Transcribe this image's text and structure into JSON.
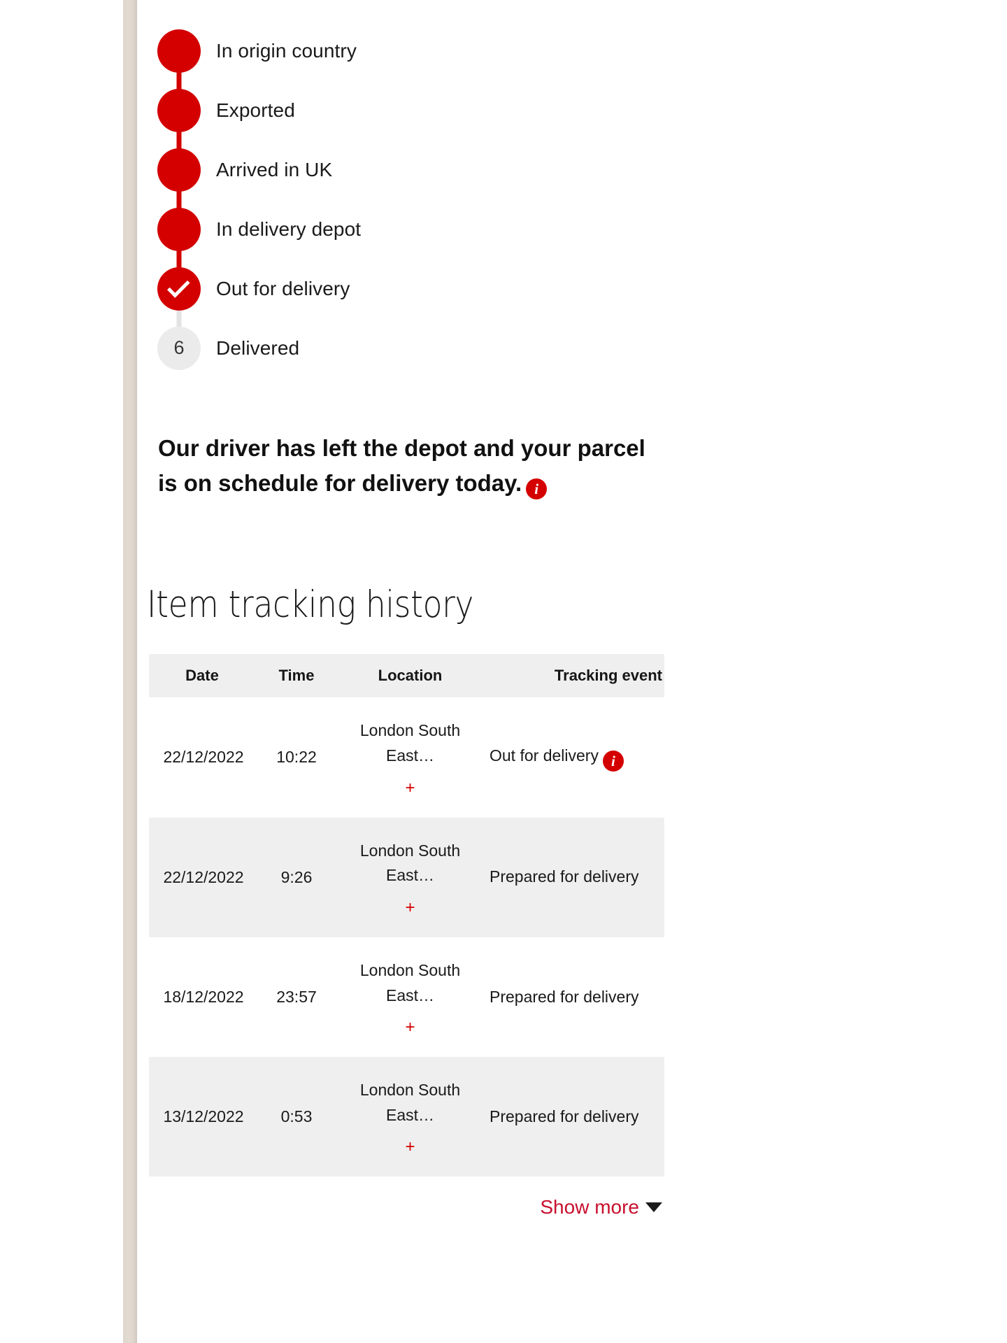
{
  "theme": {
    "brand_red": "#D40000",
    "link_red": "#C8102E",
    "pending_grey": "#EBEBEB",
    "row_alt_grey": "#EFEFEF",
    "page_edge": "#DED7CE"
  },
  "tracker": {
    "steps": [
      {
        "label": "In origin country",
        "state": "complete",
        "marker": ""
      },
      {
        "label": "Exported",
        "state": "complete",
        "marker": ""
      },
      {
        "label": "Arrived in UK",
        "state": "complete",
        "marker": ""
      },
      {
        "label": "In delivery depot",
        "state": "complete",
        "marker": ""
      },
      {
        "label": "Out for delivery",
        "state": "current",
        "marker": "check-icon"
      },
      {
        "label": "Delivered",
        "state": "pending",
        "marker": "6"
      }
    ]
  },
  "status": {
    "message": "Our driver has left the depot and your parcel is on schedule for delivery today.",
    "info_icon": "info-icon",
    "info_glyph": "i"
  },
  "history": {
    "title": "Item tracking history",
    "columns": {
      "date": "Date",
      "time": "Time",
      "location": "Location",
      "event": "Tracking event"
    },
    "rows": [
      {
        "date": "22/12/2022",
        "time": "10:22",
        "location": "London South East…",
        "expander": "+",
        "event": "Out for delivery",
        "has_info": true
      },
      {
        "date": "22/12/2022",
        "time": "9:26",
        "location": "London South East…",
        "expander": "+",
        "event": "Prepared for delivery",
        "has_info": false
      },
      {
        "date": "18/12/2022",
        "time": "23:57",
        "location": "London South East…",
        "expander": "+",
        "event": "Prepared for delivery",
        "has_info": false
      },
      {
        "date": "13/12/2022",
        "time": "0:53",
        "location": "London South East…",
        "expander": "+",
        "event": "Prepared for delivery",
        "has_info": false
      }
    ],
    "show_more": "Show more",
    "show_more_icon": "chevron-down-icon"
  }
}
